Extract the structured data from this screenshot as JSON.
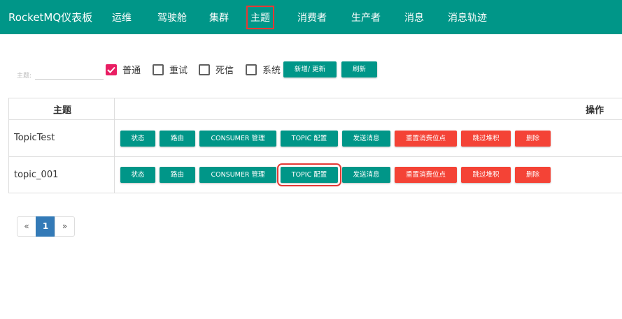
{
  "nav": {
    "brand": "RocketMQ仪表板",
    "items": [
      "运维",
      "驾驶舱",
      "集群",
      "主题",
      "消费者",
      "生产者",
      "消息",
      "消息轨迹"
    ],
    "active_index": 3
  },
  "filter": {
    "label": "主题:",
    "value": "",
    "checkboxes": [
      {
        "label": "普通",
        "checked": true
      },
      {
        "label": "重试",
        "checked": false
      },
      {
        "label": "死信",
        "checked": false
      },
      {
        "label": "系统",
        "checked": false
      }
    ],
    "add_update_label": "新增/ 更新",
    "refresh_label": "刷新"
  },
  "table": {
    "headers": [
      "主题",
      "操作"
    ],
    "action_labels": [
      "状态",
      "路由",
      "CONSUMER 管理",
      "TOPIC 配置",
      "发送消息",
      "重置消费位点",
      "跳过堆积",
      "删除"
    ],
    "rows": [
      {
        "topic": "TopicTest"
      },
      {
        "topic": "topic_001"
      }
    ]
  },
  "pagination": {
    "prev": "«",
    "current": "1",
    "next": "»"
  },
  "colors": {
    "primary": "#009688",
    "danger": "#f44336",
    "checkbox": "#e91e63",
    "highlight": "#e53935",
    "page_active": "#337ab7"
  }
}
